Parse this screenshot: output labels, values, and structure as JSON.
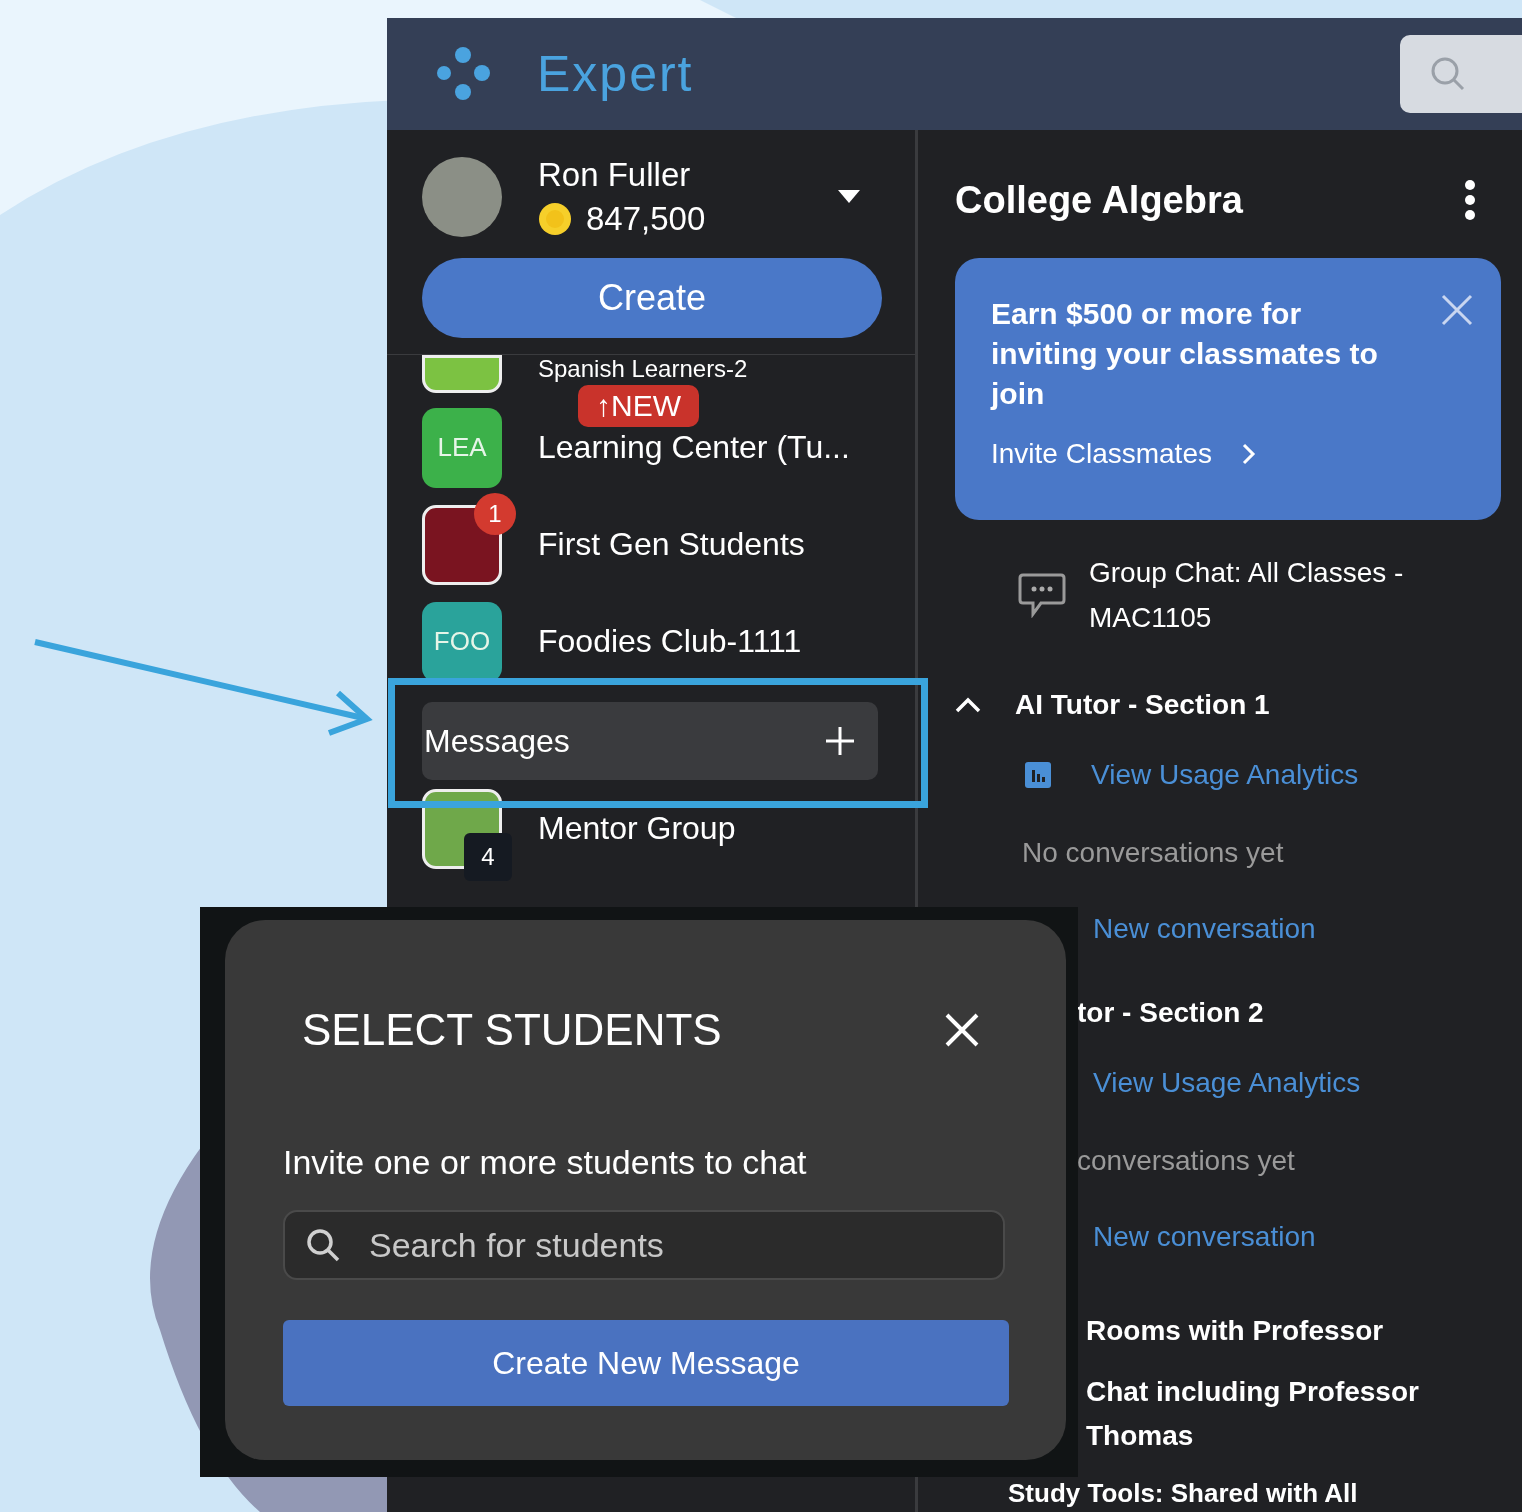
{
  "app": {
    "logo_text": "Expert"
  },
  "user": {
    "name": "Ron Fuller",
    "coins": "847,500"
  },
  "create_button": "Create",
  "new_tag": "↑NEW",
  "groups": [
    {
      "name": "Spanish Learners-2",
      "icon": {
        "kind": "photo",
        "color": "#7cc242"
      }
    },
    {
      "name": "Learning Center (Tu...",
      "icon": {
        "kind": "initials",
        "text": "LEA",
        "color": "#3cb14a"
      }
    },
    {
      "name": "First Gen Students",
      "icon": {
        "kind": "photo",
        "color": "#7a1420"
      },
      "badge": {
        "kind": "alert",
        "text": "1"
      }
    },
    {
      "name": "Foodies Club-1111",
      "icon": {
        "kind": "initials",
        "text": "FOO",
        "color": "#2aa39b"
      }
    }
  ],
  "messages": {
    "label": "Messages"
  },
  "more_groups": [
    {
      "name": "Mentor Group",
      "icon": {
        "kind": "photo",
        "color": "#6fa84a"
      },
      "badge": {
        "kind": "count",
        "text": "4"
      }
    }
  ],
  "course": {
    "title": "College Algebra"
  },
  "promo": {
    "text": "Earn $500 or more for inviting your classmates to join",
    "link": "Invite Classmates"
  },
  "group_chat": "Group Chat: All Classes - MAC1105",
  "sections": [
    {
      "title": "AI Tutor - Section 1",
      "expanded": true,
      "analytics": "View Usage Analytics",
      "empty": "No conversations yet",
      "new": "New conversation"
    },
    {
      "title": "tor - Section 2",
      "analytics": "View Usage Analytics",
      "empty": "conversations yet",
      "new": "New conversation"
    }
  ],
  "rooms": {
    "title": "Rooms with Professor",
    "items": [
      "Chat including Professor Thomas"
    ]
  },
  "study_tools": "Study Tools: Shared with All",
  "modal": {
    "title": "SELECT STUDENTS",
    "text": "Invite one or more students to chat",
    "search_placeholder": "Search for students",
    "button": "Create New Message"
  }
}
